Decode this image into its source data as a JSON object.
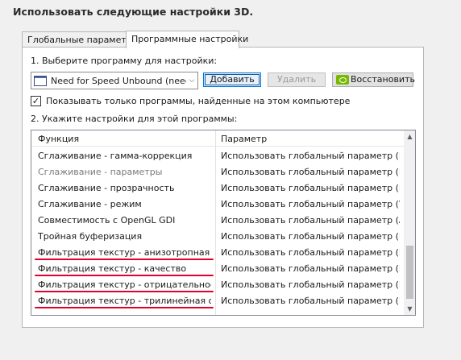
{
  "heading": "Использовать следующие настройки 3D.",
  "tabs": [
    {
      "label": "Глобальные параметры",
      "active": false
    },
    {
      "label": "Программные настройки",
      "active": true
    }
  ],
  "step1_label": "1. Выберите программу для настройки:",
  "program_select": {
    "value": "Need for Speed Unbound (need...",
    "icon": "app-window-icon"
  },
  "buttons": {
    "add": "Добавить",
    "remove": "Удалить",
    "restore": "Восстановить",
    "restore_icon": "nvidia-logo-icon"
  },
  "show_only_checkbox": {
    "label": "Показывать только программы, найденные на этом компьютере",
    "checked": true,
    "mark": "✓"
  },
  "step2_label": "2. Укажите настройки для этой программы:",
  "settings_table": {
    "columns": [
      "Функция",
      "Параметр"
    ],
    "rows": [
      {
        "feature": "Сглаживание - гамма-коррекция",
        "value": "Использовать глобальный параметр (Вкл)",
        "dimmed": false,
        "underlined": false
      },
      {
        "feature": "Сглаживание - параметры",
        "value": "Использовать глобальный параметр (В...",
        "dimmed": true,
        "underlined": false
      },
      {
        "feature": "Сглаживание - прозрачность",
        "value": "Использовать глобальный параметр (В...",
        "dimmed": false,
        "underlined": false
      },
      {
        "feature": "Сглаживание - режим",
        "value": "Использовать глобальный параметр (У...",
        "dimmed": false,
        "underlined": false
      },
      {
        "feature": "Совместимость с OpenGL GDI",
        "value": "Использовать глобальный параметр (А...",
        "dimmed": false,
        "underlined": false
      },
      {
        "feature": "Тройная буферизация",
        "value": "Использовать глобальный параметр (В...",
        "dimmed": false,
        "underlined": false
      },
      {
        "feature": "Фильтрация текстур - анизотропная оп...",
        "value": "Использовать глобальный параметр (В...",
        "dimmed": false,
        "underlined": true
      },
      {
        "feature": "Фильтрация текстур - качество",
        "value": "Использовать глобальный параметр (К...",
        "dimmed": false,
        "underlined": true
      },
      {
        "feature": "Фильтрация текстур - отрицательное о...",
        "value": "Использовать глобальный параметр (П...",
        "dimmed": false,
        "underlined": true
      },
      {
        "feature": "Фильтрация текстур - трилинейная опт...",
        "value": "Использовать глобальный параметр (В...",
        "dimmed": false,
        "underlined": true
      }
    ]
  },
  "scrollbar": {
    "up_icon": "▲",
    "down_icon": "▼"
  },
  "colors": {
    "underline": "#e3002b",
    "nvidia_green": "#76b900",
    "focus_blue": "#0078d7"
  }
}
